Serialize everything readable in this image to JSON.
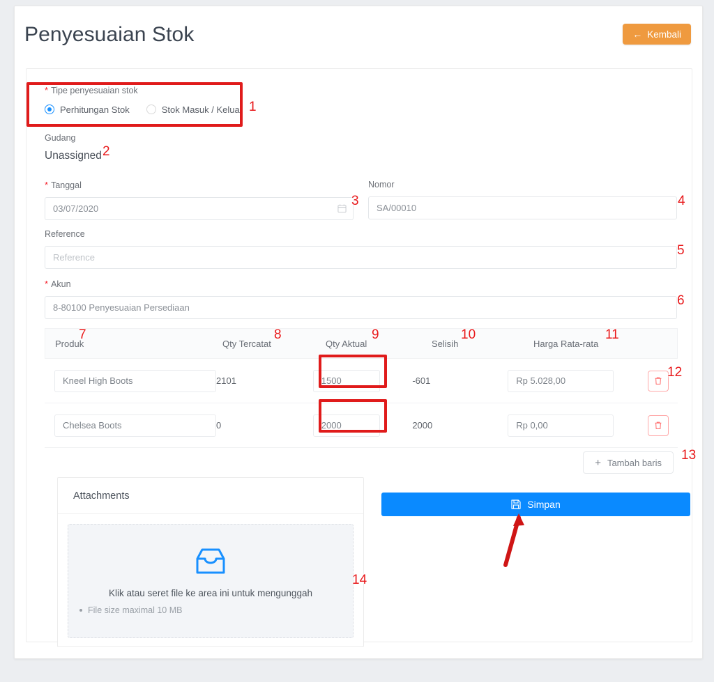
{
  "header": {
    "title": "Penyesuaian Stok",
    "back_button": {
      "label": "Kembali",
      "icon": "arrow-left-icon",
      "color": "#ef9a3f"
    }
  },
  "form": {
    "type_label": "Tipe penyesuaian stok",
    "type_options": [
      {
        "label": "Perhitungan Stok",
        "selected": true
      },
      {
        "label": "Stok Masuk / Keluar",
        "selected": false
      }
    ],
    "warehouse_label": "Gudang",
    "warehouse_value": "Unassigned",
    "date_label": "Tanggal",
    "date_value": "03/07/2020",
    "number_label": "Nomor",
    "number_value": "SA/00010",
    "reference_label": "Reference",
    "reference_value": "",
    "reference_placeholder": "Reference",
    "account_label": "Akun",
    "account_value": "8-80100 Penyesuaian Persediaan"
  },
  "table": {
    "columns": [
      "Produk",
      "Qty Tercatat",
      "Qty Aktual",
      "Selisih",
      "Harga Rata-rata"
    ],
    "rows": [
      {
        "produk": "Kneel High Boots",
        "qty_tercatat": "2101",
        "qty_aktual": "1500",
        "selisih": "-601",
        "harga_rata_rata": "Rp 5.028,00",
        "delete_icon": "trash-icon"
      },
      {
        "produk": "Chelsea Boots",
        "qty_tercatat": "0",
        "qty_aktual": "2000",
        "selisih": "2000",
        "harga_rata_rata": "Rp 0,00",
        "delete_icon": "trash-icon"
      }
    ],
    "add_row_label": "Tambah baris",
    "add_row_icon": "plus-icon"
  },
  "attachments": {
    "title": "Attachments",
    "dropzone_icon": "inbox-icon",
    "dropzone_message": "Klik atau seret file ke area ini untuk mengunggah",
    "hint": "File size maximal 10 MB"
  },
  "actions": {
    "save_label": "Simpan",
    "save_icon": "save-icon",
    "save_color": "#0a8aff"
  },
  "annotations": {
    "color": "#e8191b",
    "markers": [
      "1",
      "2",
      "3",
      "4",
      "5",
      "6",
      "7",
      "8",
      "9",
      "10",
      "11",
      "12",
      "13",
      "14"
    ]
  }
}
